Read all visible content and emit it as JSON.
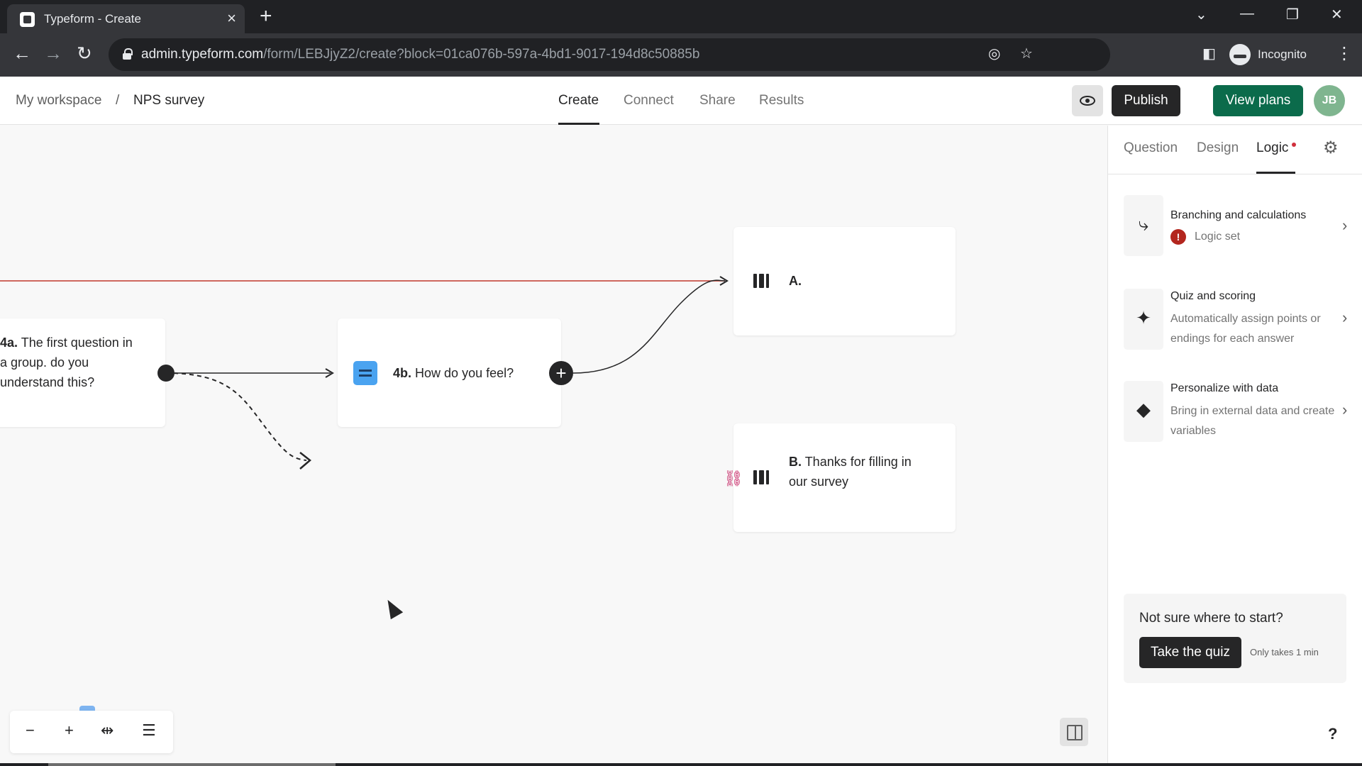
{
  "browser": {
    "tab_title": "Typeform - Create",
    "url_host": "admin.typeform.com",
    "url_path": "/form/LEBJjyZ2/create?block=01ca076b-597a-4bd1-9017-194d8c50885b",
    "profile_label": "Incognito"
  },
  "header": {
    "breadcrumb": [
      "My workspace",
      "NPS survey"
    ],
    "separator": "/",
    "tabs": [
      "Create",
      "Connect",
      "Share",
      "Results"
    ],
    "active_tab": "Create",
    "publish_label": "Publish",
    "view_plans_label": "View plans",
    "avatar_initials": "JB"
  },
  "canvas": {
    "card_4a": {
      "num": "4a.",
      "text_lines": [
        "The first question in",
        "a group. do you",
        "understand this?"
      ]
    },
    "card_4b": {
      "num": "4b.",
      "text": "How do you feel?"
    },
    "ending_a": {
      "num": "A.",
      "text": ""
    },
    "ending_b": {
      "num": "B.",
      "text_lines": [
        "Thanks for filling in",
        "our survey"
      ]
    },
    "colors": {
      "logic_line": "#c0392b",
      "question_icon": "#4aa3f0"
    }
  },
  "panel": {
    "tabs": [
      "Question",
      "Design",
      "Logic"
    ],
    "active_tab": "Logic",
    "items": [
      {
        "title": "Branching and calculations",
        "desc": "Logic set",
        "icon": "branch-icon"
      },
      {
        "title": "Quiz and scoring",
        "desc": "Automatically assign points or endings for each answer",
        "icon": "sparkle-icon"
      },
      {
        "title": "Personalize with data",
        "desc": "Bring in external data and create variables",
        "icon": "tag-icon"
      }
    ],
    "quiz_prompt": "Not sure where to start?",
    "quiz_button": "Take the quiz",
    "quiz_note": "Only takes 1 min",
    "help": "?"
  }
}
